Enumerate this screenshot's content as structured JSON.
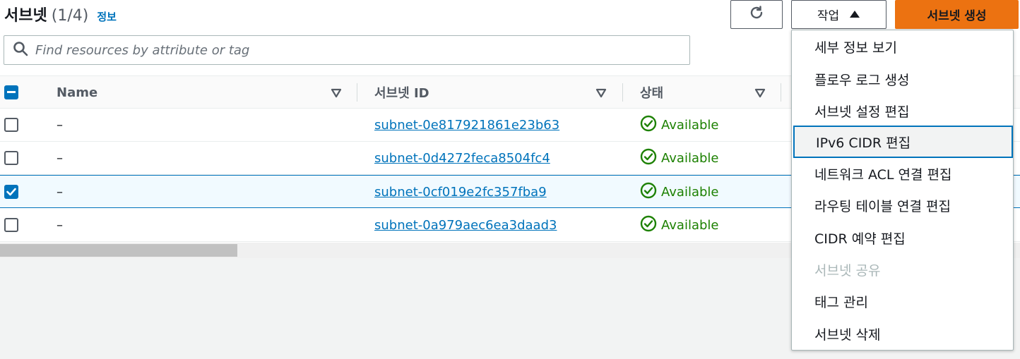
{
  "header": {
    "title": "서브넷",
    "count": "(1/4)",
    "info_link": "정보",
    "actions_label": "작업",
    "create_label": "서브넷 생성"
  },
  "search": {
    "placeholder": "Find resources by attribute or tag"
  },
  "table": {
    "columns": [
      "Name",
      "서브넷 ID",
      "상태"
    ],
    "rows": [
      {
        "name": "–",
        "subnet_id": "subnet-0e817921861e23b63",
        "state": "Available",
        "selected": false
      },
      {
        "name": "–",
        "subnet_id": "subnet-0d4272feca8504fc4",
        "state": "Available",
        "selected": false
      },
      {
        "name": "–",
        "subnet_id": "subnet-0cf019e2fc357fba9",
        "state": "Available",
        "selected": true
      },
      {
        "name": "–",
        "subnet_id": "subnet-0a979aec6ea3daad3",
        "state": "Available",
        "selected": false
      }
    ]
  },
  "menu": {
    "items": [
      {
        "label": "세부 정보 보기",
        "state": "normal"
      },
      {
        "label": "플로우 로그 생성",
        "state": "normal"
      },
      {
        "label": "서브넷 설정 편집",
        "state": "normal"
      },
      {
        "label": "IPv6 CIDR 편집",
        "state": "highlighted"
      },
      {
        "label": "네트워크 ACL 연결 편집",
        "state": "normal"
      },
      {
        "label": "라우팅 테이블 연결 편집",
        "state": "normal"
      },
      {
        "label": "CIDR 예약 편집",
        "state": "normal"
      },
      {
        "label": "서브넷 공유",
        "state": "disabled"
      },
      {
        "label": "태그 관리",
        "state": "normal"
      },
      {
        "label": "서브넷 삭제",
        "state": "normal"
      }
    ]
  },
  "colors": {
    "primary": "#ec7211",
    "link": "#0073bb",
    "success": "#1d8102",
    "disabled": "#aab7b8"
  },
  "icons": {
    "refresh": "refresh-icon",
    "caret_up": "caret-up-icon",
    "search": "search-icon",
    "sort": "sort-down-icon",
    "status": "check-circle-icon"
  }
}
